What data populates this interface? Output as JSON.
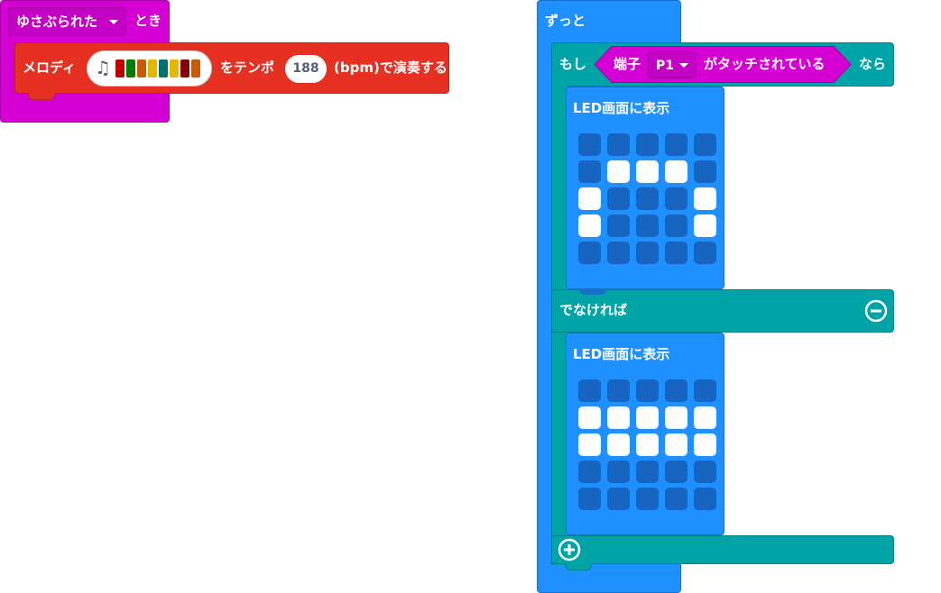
{
  "event_block": {
    "gesture_value": "ゆさぶられた",
    "suffix": "とき"
  },
  "melody_block": {
    "prefix": "メロディ",
    "icon": "music-note-icon",
    "note_colors": [
      "#c00000",
      "#007c00",
      "#c85a00",
      "#e2b800",
      "#006f6f",
      "#e2b800",
      "#8b0000",
      "#c85a00"
    ],
    "middle": "をテンポ",
    "tempo": "188",
    "suffix": "(bpm)で演奏する"
  },
  "forever_block": {
    "label": "ずっと",
    "if": {
      "prefix": "もし",
      "condition_prefix": "端子",
      "pin": "P1",
      "condition_suffix": "がタッチされている",
      "suffix": "なら",
      "show_leds_label": "LED画面に表示",
      "leds": [
        [
          0,
          0,
          0,
          0,
          0
        ],
        [
          0,
          1,
          1,
          1,
          0
        ],
        [
          1,
          0,
          0,
          0,
          1
        ],
        [
          1,
          0,
          0,
          0,
          1
        ],
        [
          0,
          0,
          0,
          0,
          0
        ]
      ]
    },
    "else": {
      "label": "でなければ",
      "show_leds_label": "LED画面に表示",
      "leds": [
        [
          0,
          0,
          0,
          0,
          0
        ],
        [
          1,
          1,
          1,
          1,
          1
        ],
        [
          1,
          1,
          1,
          1,
          1
        ],
        [
          0,
          0,
          0,
          0,
          0
        ],
        [
          0,
          0,
          0,
          0,
          0
        ]
      ]
    },
    "remove_icon": "minus-circle-icon",
    "add_icon": "plus-circle-icon"
  }
}
